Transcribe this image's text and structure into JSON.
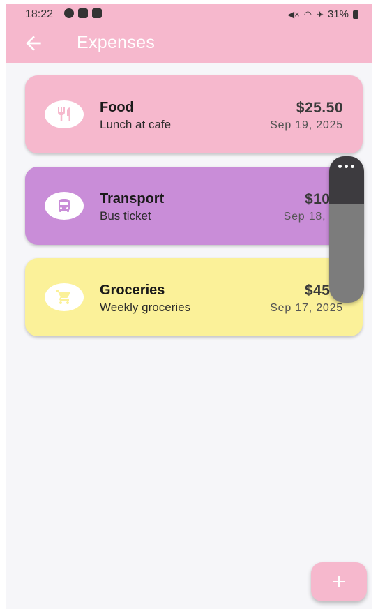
{
  "status_bar": {
    "time": "18:22",
    "battery": "31%"
  },
  "app_bar": {
    "title": "Expenses"
  },
  "expenses": [
    {
      "category": "Food",
      "description": "Lunch at cafe",
      "amount": "$25.50",
      "date": "Sep 19, 2025",
      "color": "#f6b8cd",
      "icon": "restaurant-icon"
    },
    {
      "category": "Transport",
      "description": "Bus ticket",
      "amount": "$10.0",
      "date": "Sep 18, 20",
      "color": "#c98dd8",
      "icon": "bus-icon"
    },
    {
      "category": "Groceries",
      "description": "Weekly groceries",
      "amount": "$45.9",
      "date": "Sep 17, 2025",
      "color": "#fbf199",
      "icon": "cart-icon"
    }
  ],
  "fab": {
    "icon": "add-icon"
  },
  "colors": {
    "primary": "#f6b8cd",
    "background": "#f6f6f9"
  }
}
